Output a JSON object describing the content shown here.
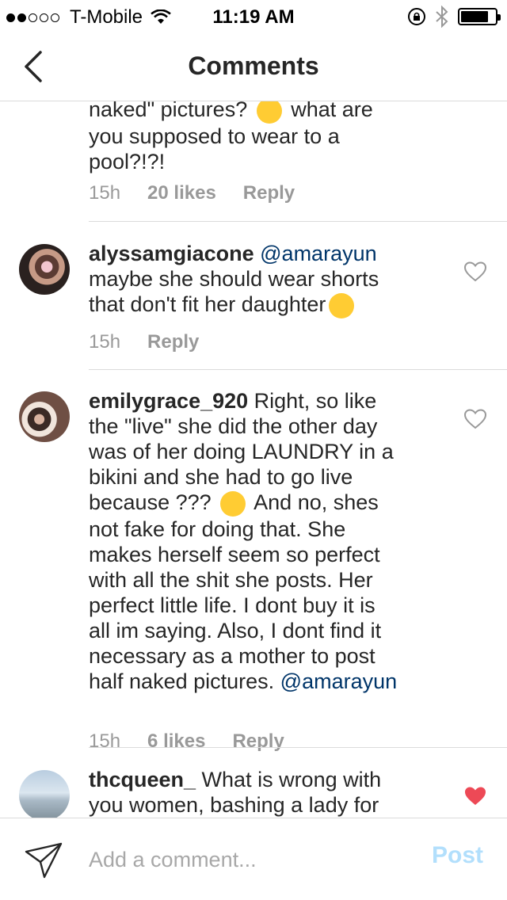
{
  "status_bar": {
    "carrier": "T-Mobile",
    "time": "11:19 AM",
    "signal_bars_filled": 2,
    "signal_bars_total": 5,
    "battery_level": 0.8,
    "icons": [
      "wifi-icon",
      "rotation-lock-icon",
      "bluetooth-icon",
      "battery-icon"
    ]
  },
  "nav": {
    "title": "Comments",
    "back_icon": "chevron-left-icon"
  },
  "comments": [
    {
      "text_lines": [
        "naked\" pictures? ",
        " what are",
        "you supposed to wear to a",
        "pool?!?!"
      ],
      "emoji": "rolling-laughing-emoji",
      "time": "15h",
      "likes": "20 likes",
      "reply": "Reply"
    },
    {
      "username": "alyssamgiacone",
      "mention": "@amarayun",
      "text_lines": [
        "maybe she should wear shorts",
        "that don't fit her daughter"
      ],
      "emoji": "flushed-emoji",
      "time": "15h",
      "reply": "Reply",
      "liked": false
    },
    {
      "username": "emilygrace_920",
      "text_head": "Right, so like",
      "text_lines": [
        "the \"live\" she did the other day",
        "was of her doing LAUNDRY in a",
        "bikini and she had to go live",
        "because ??? ",
        " And no, shes",
        "not fake for doing that. She",
        "makes herself seem so perfect",
        "with all the shit she posts. Her",
        "perfect little life. I dont buy it is",
        "all im saying. Also, I dont find it",
        "necessary as a mother to post",
        "half naked pictures. "
      ],
      "mention": "@amarayun",
      "emoji": "thinking-emoji",
      "time": "15h",
      "likes": "6 likes",
      "reply": "Reply",
      "liked": false
    },
    {
      "username": "thcqueen_",
      "text_head": "What is wrong with",
      "text_lines": [
        "you women, bashing a lady for"
      ],
      "liked": true
    }
  ],
  "input": {
    "placeholder": "Add a comment...",
    "post_label": "Post",
    "send_icon": "paper-plane-icon"
  },
  "colors": {
    "text": "#262626",
    "muted": "#999999",
    "mention": "#003569",
    "heart_active": "#ed4956",
    "post_disabled": "#b2dffc"
  }
}
